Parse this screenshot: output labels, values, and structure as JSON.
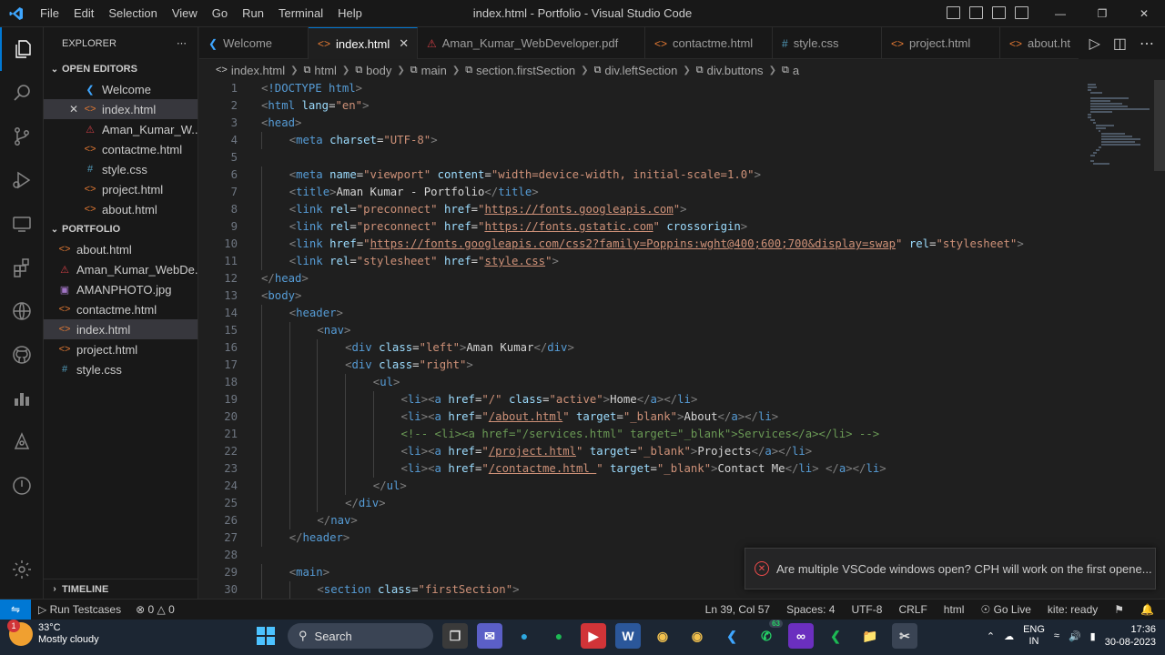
{
  "window": {
    "title": "index.html - Portfolio - Visual Studio Code",
    "menu": [
      "File",
      "Edit",
      "Selection",
      "View",
      "Go",
      "Run",
      "Terminal",
      "Help"
    ]
  },
  "explorer": {
    "header": "EXPLORER",
    "open_editors_label": "OPEN EDITORS",
    "open_editors": [
      {
        "name": "Welcome",
        "icon": "vscode-icon"
      },
      {
        "name": "index.html",
        "icon": "html-icon"
      },
      {
        "name": "Aman_Kumar_W...",
        "icon": "pdf-icon"
      },
      {
        "name": "contactme.html",
        "icon": "html-icon"
      },
      {
        "name": "style.css",
        "icon": "css-icon"
      },
      {
        "name": "project.html",
        "icon": "html-icon"
      },
      {
        "name": "about.html",
        "icon": "html-icon"
      }
    ],
    "folder_label": "PORTFOLIO",
    "files": [
      {
        "name": "about.html",
        "icon": "html-icon"
      },
      {
        "name": "Aman_Kumar_WebDe...",
        "icon": "pdf-icon"
      },
      {
        "name": "AMANPHOTO.jpg",
        "icon": "image-icon"
      },
      {
        "name": "contactme.html",
        "icon": "html-icon"
      },
      {
        "name": "index.html",
        "icon": "html-icon"
      },
      {
        "name": "project.html",
        "icon": "html-icon"
      },
      {
        "name": "style.css",
        "icon": "css-icon"
      }
    ],
    "timeline_label": "TIMELINE"
  },
  "tabs": [
    {
      "label": "Welcome",
      "icon": "vscode-icon",
      "active": false
    },
    {
      "label": "index.html",
      "icon": "html-icon",
      "active": true
    },
    {
      "label": "Aman_Kumar_WebDeveloper.pdf",
      "icon": "pdf-icon",
      "active": false
    },
    {
      "label": "contactme.html",
      "icon": "html-icon",
      "active": false
    },
    {
      "label": "style.css",
      "icon": "css-icon",
      "active": false
    },
    {
      "label": "project.html",
      "icon": "html-icon",
      "active": false
    },
    {
      "label": "about.ht",
      "icon": "html-icon",
      "active": false
    }
  ],
  "breadcrumb": [
    "index.html",
    "html",
    "body",
    "main",
    "section.firstSection",
    "div.leftSection",
    "div.buttons",
    "a"
  ],
  "code_lines": [
    {
      "n": "1",
      "indent": 0,
      "tokens": [
        [
          "br",
          "<"
        ],
        [
          "tag",
          "!DOCTYPE"
        ],
        [
          "txt",
          " "
        ],
        [
          "tag",
          "html"
        ],
        [
          "br",
          ">"
        ]
      ]
    },
    {
      "n": "2",
      "indent": 0,
      "tokens": [
        [
          "br",
          "<"
        ],
        [
          "tag",
          "html"
        ],
        [
          "txt",
          " "
        ],
        [
          "attr",
          "lang"
        ],
        [
          "txt",
          "="
        ],
        [
          "str",
          "\"en\""
        ],
        [
          "br",
          ">"
        ]
      ]
    },
    {
      "n": "3",
      "indent": 0,
      "tokens": [
        [
          "br",
          "<"
        ],
        [
          "tag",
          "head"
        ],
        [
          "br",
          ">"
        ]
      ]
    },
    {
      "n": "4",
      "indent": 1,
      "tokens": [
        [
          "br",
          "<"
        ],
        [
          "tag",
          "meta"
        ],
        [
          "txt",
          " "
        ],
        [
          "attr",
          "charset"
        ],
        [
          "txt",
          "="
        ],
        [
          "str",
          "\"UTF-8\""
        ],
        [
          "br",
          ">"
        ]
      ]
    },
    {
      "n": "5",
      "indent": 0,
      "tokens": []
    },
    {
      "n": "6",
      "indent": 1,
      "tokens": [
        [
          "br",
          "<"
        ],
        [
          "tag",
          "meta"
        ],
        [
          "txt",
          " "
        ],
        [
          "attr",
          "name"
        ],
        [
          "txt",
          "="
        ],
        [
          "str",
          "\"viewport\""
        ],
        [
          "txt",
          " "
        ],
        [
          "attr",
          "content"
        ],
        [
          "txt",
          "="
        ],
        [
          "str",
          "\"width=device-width, initial-scale=1.0\""
        ],
        [
          "br",
          ">"
        ]
      ]
    },
    {
      "n": "7",
      "indent": 1,
      "tokens": [
        [
          "br",
          "<"
        ],
        [
          "tag",
          "title"
        ],
        [
          "br",
          ">"
        ],
        [
          "txt",
          "Aman Kumar - Portfolio"
        ],
        [
          "br",
          "</"
        ],
        [
          "tag",
          "title"
        ],
        [
          "br",
          ">"
        ]
      ]
    },
    {
      "n": "8",
      "indent": 1,
      "tokens": [
        [
          "br",
          "<"
        ],
        [
          "tag",
          "link"
        ],
        [
          "txt",
          " "
        ],
        [
          "attr",
          "rel"
        ],
        [
          "txt",
          "="
        ],
        [
          "str",
          "\"preconnect\""
        ],
        [
          "txt",
          " "
        ],
        [
          "attr",
          "href"
        ],
        [
          "txt",
          "="
        ],
        [
          "str",
          "\""
        ],
        [
          "link",
          "https://fonts.googleapis.com"
        ],
        [
          "str",
          "\""
        ],
        [
          "br",
          ">"
        ]
      ]
    },
    {
      "n": "9",
      "indent": 1,
      "tokens": [
        [
          "br",
          "<"
        ],
        [
          "tag",
          "link"
        ],
        [
          "txt",
          " "
        ],
        [
          "attr",
          "rel"
        ],
        [
          "txt",
          "="
        ],
        [
          "str",
          "\"preconnect\""
        ],
        [
          "txt",
          " "
        ],
        [
          "attr",
          "href"
        ],
        [
          "txt",
          "="
        ],
        [
          "str",
          "\""
        ],
        [
          "link",
          "https://fonts.gstatic.com"
        ],
        [
          "str",
          "\""
        ],
        [
          "txt",
          " "
        ],
        [
          "attr",
          "crossorigin"
        ],
        [
          "br",
          ">"
        ]
      ]
    },
    {
      "n": "10",
      "indent": 1,
      "tokens": [
        [
          "br",
          "<"
        ],
        [
          "tag",
          "link"
        ],
        [
          "txt",
          " "
        ],
        [
          "attr",
          "href"
        ],
        [
          "txt",
          "="
        ],
        [
          "str",
          "\""
        ],
        [
          "link",
          "https://fonts.googleapis.com/css2?family=Poppins:wght@400;600;700&display=swap"
        ],
        [
          "str",
          "\""
        ],
        [
          "txt",
          " "
        ],
        [
          "attr",
          "rel"
        ],
        [
          "txt",
          "="
        ],
        [
          "str",
          "\"stylesheet\""
        ],
        [
          "br",
          ">"
        ]
      ]
    },
    {
      "n": "11",
      "indent": 1,
      "tokens": [
        [
          "br",
          "<"
        ],
        [
          "tag",
          "link"
        ],
        [
          "txt",
          " "
        ],
        [
          "attr",
          "rel"
        ],
        [
          "txt",
          "="
        ],
        [
          "str",
          "\"stylesheet\""
        ],
        [
          "txt",
          " "
        ],
        [
          "attr",
          "href"
        ],
        [
          "txt",
          "="
        ],
        [
          "str",
          "\""
        ],
        [
          "link",
          "style.css"
        ],
        [
          "str",
          "\""
        ],
        [
          "br",
          ">"
        ]
      ]
    },
    {
      "n": "12",
      "indent": 0,
      "tokens": [
        [
          "br",
          "</"
        ],
        [
          "tag",
          "head"
        ],
        [
          "br",
          ">"
        ]
      ]
    },
    {
      "n": "13",
      "indent": 0,
      "tokens": [
        [
          "br",
          "<"
        ],
        [
          "tag",
          "body"
        ],
        [
          "br",
          ">"
        ]
      ]
    },
    {
      "n": "14",
      "indent": 1,
      "tokens": [
        [
          "br",
          "<"
        ],
        [
          "tag",
          "header"
        ],
        [
          "br",
          ">"
        ]
      ]
    },
    {
      "n": "15",
      "indent": 2,
      "tokens": [
        [
          "br",
          "<"
        ],
        [
          "tag",
          "nav"
        ],
        [
          "br",
          ">"
        ]
      ]
    },
    {
      "n": "16",
      "indent": 3,
      "tokens": [
        [
          "br",
          "<"
        ],
        [
          "tag",
          "div"
        ],
        [
          "txt",
          " "
        ],
        [
          "attr",
          "class"
        ],
        [
          "txt",
          "="
        ],
        [
          "str",
          "\"left\""
        ],
        [
          "br",
          ">"
        ],
        [
          "txt",
          "Aman Kumar"
        ],
        [
          "br",
          "</"
        ],
        [
          "tag",
          "div"
        ],
        [
          "br",
          ">"
        ]
      ]
    },
    {
      "n": "17",
      "indent": 3,
      "tokens": [
        [
          "br",
          "<"
        ],
        [
          "tag",
          "div"
        ],
        [
          "txt",
          " "
        ],
        [
          "attr",
          "class"
        ],
        [
          "txt",
          "="
        ],
        [
          "str",
          "\"right\""
        ],
        [
          "br",
          ">"
        ]
      ]
    },
    {
      "n": "18",
      "indent": 4,
      "tokens": [
        [
          "br",
          "<"
        ],
        [
          "tag",
          "ul"
        ],
        [
          "br",
          ">"
        ]
      ]
    },
    {
      "n": "19",
      "indent": 5,
      "tokens": [
        [
          "br",
          "<"
        ],
        [
          "tag",
          "li"
        ],
        [
          "br",
          "><"
        ],
        [
          "tag",
          "a"
        ],
        [
          "txt",
          " "
        ],
        [
          "attr",
          "href"
        ],
        [
          "txt",
          "="
        ],
        [
          "str",
          "\"/\""
        ],
        [
          "txt",
          " "
        ],
        [
          "attr",
          "class"
        ],
        [
          "txt",
          "="
        ],
        [
          "str",
          "\"active\""
        ],
        [
          "br",
          ">"
        ],
        [
          "txt",
          "Home"
        ],
        [
          "br",
          "</"
        ],
        [
          "tag",
          "a"
        ],
        [
          "br",
          "></"
        ],
        [
          "tag",
          "li"
        ],
        [
          "br",
          ">"
        ]
      ]
    },
    {
      "n": "20",
      "indent": 5,
      "tokens": [
        [
          "br",
          "<"
        ],
        [
          "tag",
          "li"
        ],
        [
          "br",
          "><"
        ],
        [
          "tag",
          "a"
        ],
        [
          "txt",
          " "
        ],
        [
          "attr",
          "href"
        ],
        [
          "txt",
          "="
        ],
        [
          "str",
          "\""
        ],
        [
          "link",
          "/about.html"
        ],
        [
          "str",
          "\""
        ],
        [
          "txt",
          " "
        ],
        [
          "attr",
          "target"
        ],
        [
          "txt",
          "="
        ],
        [
          "str",
          "\"_blank\""
        ],
        [
          "br",
          ">"
        ],
        [
          "txt",
          "About"
        ],
        [
          "br",
          "</"
        ],
        [
          "tag",
          "a"
        ],
        [
          "br",
          "></"
        ],
        [
          "tag",
          "li"
        ],
        [
          "br",
          ">"
        ]
      ]
    },
    {
      "n": "21",
      "indent": 5,
      "tokens": [
        [
          "com",
          "<!-- <li><a href=\"/services.html\" target=\"_blank\">Services</a></li> -->"
        ]
      ]
    },
    {
      "n": "22",
      "indent": 5,
      "tokens": [
        [
          "br",
          "<"
        ],
        [
          "tag",
          "li"
        ],
        [
          "br",
          "><"
        ],
        [
          "tag",
          "a"
        ],
        [
          "txt",
          " "
        ],
        [
          "attr",
          "href"
        ],
        [
          "txt",
          "="
        ],
        [
          "str",
          "\""
        ],
        [
          "link",
          "/project.html"
        ],
        [
          "str",
          "\""
        ],
        [
          "txt",
          " "
        ],
        [
          "attr",
          "target"
        ],
        [
          "txt",
          "="
        ],
        [
          "str",
          "\"_blank\""
        ],
        [
          "br",
          ">"
        ],
        [
          "txt",
          "Projects"
        ],
        [
          "br",
          "</"
        ],
        [
          "tag",
          "a"
        ],
        [
          "br",
          "></"
        ],
        [
          "tag",
          "li"
        ],
        [
          "br",
          ">"
        ]
      ]
    },
    {
      "n": "23",
      "indent": 5,
      "tokens": [
        [
          "br",
          "<"
        ],
        [
          "tag",
          "li"
        ],
        [
          "br",
          "><"
        ],
        [
          "tag",
          "a"
        ],
        [
          "txt",
          " "
        ],
        [
          "attr",
          "href"
        ],
        [
          "txt",
          "="
        ],
        [
          "str",
          "\""
        ],
        [
          "link",
          "/contactme.html "
        ],
        [
          "str",
          "\""
        ],
        [
          "txt",
          " "
        ],
        [
          "attr",
          "target"
        ],
        [
          "txt",
          "="
        ],
        [
          "str",
          "\"_blank\""
        ],
        [
          "br",
          ">"
        ],
        [
          "txt",
          "Contact Me"
        ],
        [
          "br",
          "</"
        ],
        [
          "tag",
          "li"
        ],
        [
          "br",
          ">"
        ],
        [
          "txt",
          " "
        ],
        [
          "br",
          "</"
        ],
        [
          "tag",
          "a"
        ],
        [
          "br",
          "></"
        ],
        [
          "tag",
          "li"
        ],
        [
          "br",
          ">"
        ]
      ]
    },
    {
      "n": "24",
      "indent": 4,
      "tokens": [
        [
          "br",
          "</"
        ],
        [
          "tag",
          "ul"
        ],
        [
          "br",
          ">"
        ]
      ]
    },
    {
      "n": "25",
      "indent": 3,
      "tokens": [
        [
          "br",
          "</"
        ],
        [
          "tag",
          "div"
        ],
        [
          "br",
          ">"
        ]
      ]
    },
    {
      "n": "26",
      "indent": 2,
      "tokens": [
        [
          "br",
          "</"
        ],
        [
          "tag",
          "nav"
        ],
        [
          "br",
          ">"
        ]
      ]
    },
    {
      "n": "27",
      "indent": 1,
      "tokens": [
        [
          "br",
          "</"
        ],
        [
          "tag",
          "header"
        ],
        [
          "br",
          ">"
        ]
      ]
    },
    {
      "n": "28",
      "indent": 0,
      "tokens": []
    },
    {
      "n": "29",
      "indent": 1,
      "tokens": [
        [
          "br",
          "<"
        ],
        [
          "tag",
          "main"
        ],
        [
          "br",
          ">"
        ]
      ]
    },
    {
      "n": "30",
      "indent": 2,
      "tokens": [
        [
          "br",
          "<"
        ],
        [
          "tag",
          "section"
        ],
        [
          "txt",
          " "
        ],
        [
          "attr",
          "class"
        ],
        [
          "txt",
          "="
        ],
        [
          "str",
          "\"firstSection\""
        ],
        [
          "br",
          ">"
        ]
      ]
    }
  ],
  "notification": {
    "message": "Are multiple VSCode windows open? CPH will work on the first opene..."
  },
  "statusbar": {
    "run_testcases": "Run Testcases",
    "errors": "0",
    "warnings": "0",
    "position": "Ln 39, Col 57",
    "spaces": "Spaces: 4",
    "encoding": "UTF-8",
    "eol": "CRLF",
    "language": "html",
    "golive": "Go Live",
    "kite": "kite: ready"
  },
  "taskbar": {
    "weather_badge": "1",
    "temperature": "33°C",
    "condition": "Mostly cloudy",
    "search": "Search",
    "whatsapp_badge": "63",
    "lang": "ENG",
    "region": "IN",
    "time": "17:36",
    "date": "30-08-2023"
  },
  "colors": {
    "accent": "#0078d4",
    "tag": "#569cd6",
    "attr": "#9cdcfe",
    "string": "#ce9178",
    "comment": "#6a9955"
  }
}
